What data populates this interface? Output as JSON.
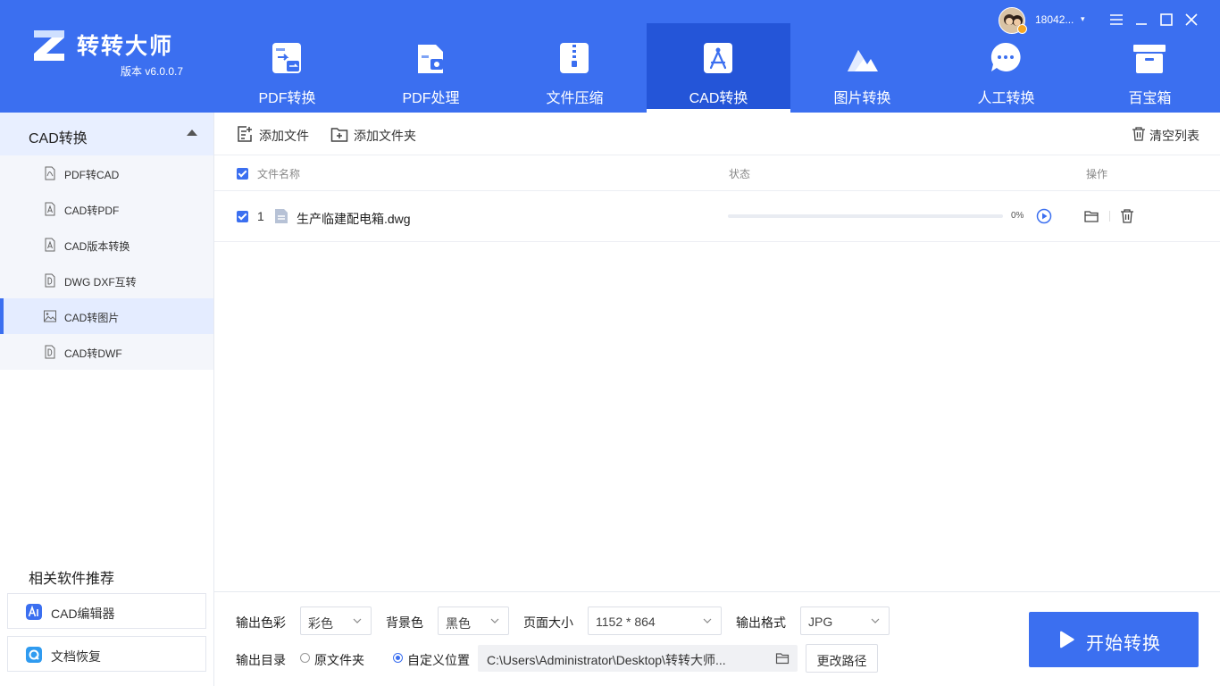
{
  "app": {
    "brand": "转转大师",
    "version": "版本 v6.0.0.7"
  },
  "user": {
    "name": "18042...",
    "caret": "▾"
  },
  "nav": {
    "tabs": [
      {
        "label": "PDF转换",
        "icon": "pdf-convert-icon"
      },
      {
        "label": "PDF处理",
        "icon": "pdf-process-icon"
      },
      {
        "label": "文件压缩",
        "icon": "file-compress-icon"
      },
      {
        "label": "CAD转换",
        "icon": "cad-convert-icon",
        "active": true
      },
      {
        "label": "图片转换",
        "icon": "image-convert-icon"
      },
      {
        "label": "人工转换",
        "icon": "manual-convert-icon"
      },
      {
        "label": "百宝箱",
        "icon": "toolbox-icon"
      }
    ]
  },
  "sidebar": {
    "section_title": "CAD转换",
    "items": [
      {
        "label": "PDF转CAD",
        "icon": "pdf-file-icon"
      },
      {
        "label": "CAD转PDF",
        "icon": "a-file-icon"
      },
      {
        "label": "CAD版本转换",
        "icon": "a-file-icon"
      },
      {
        "label": "DWG DXF互转",
        "icon": "d-file-icon"
      },
      {
        "label": "CAD转图片",
        "icon": "image-file-icon",
        "active": true
      },
      {
        "label": "CAD转DWF",
        "icon": "d-file-icon"
      }
    ],
    "recommend_title": "相关软件推荐",
    "recommend": [
      {
        "label": "CAD编辑器",
        "icon": "cad-editor-icon",
        "color": "#3b6ff0"
      },
      {
        "label": "文档恢复",
        "icon": "doc-recover-icon",
        "color": "#2f9bf0"
      }
    ]
  },
  "toolbar": {
    "add_file": "添加文件",
    "add_folder": "添加文件夹",
    "clear_list": "清空列表"
  },
  "table": {
    "headers": {
      "name": "文件名称",
      "status": "状态",
      "action": "操作"
    },
    "rows": [
      {
        "index": "1",
        "name": "生产临建配电箱.dwg",
        "progress": 0,
        "progress_text": "0%",
        "checked": true
      }
    ]
  },
  "settings": {
    "color_label": "输出色彩",
    "color_value": "彩色",
    "bg_label": "背景色",
    "bg_value": "黑色",
    "page_label": "页面大小",
    "page_value": "1152 * 864",
    "format_label": "输出格式",
    "format_value": "JPG",
    "dir_label": "输出目录",
    "radio_original": "原文件夹",
    "radio_custom": "自定义位置",
    "path": "C:\\Users\\Administrator\\Desktop\\转转大师...",
    "change_path": "更改路径",
    "start": "开始转换"
  },
  "colors": {
    "primary": "#3b6ff0",
    "primary_dark": "#2455d8"
  }
}
